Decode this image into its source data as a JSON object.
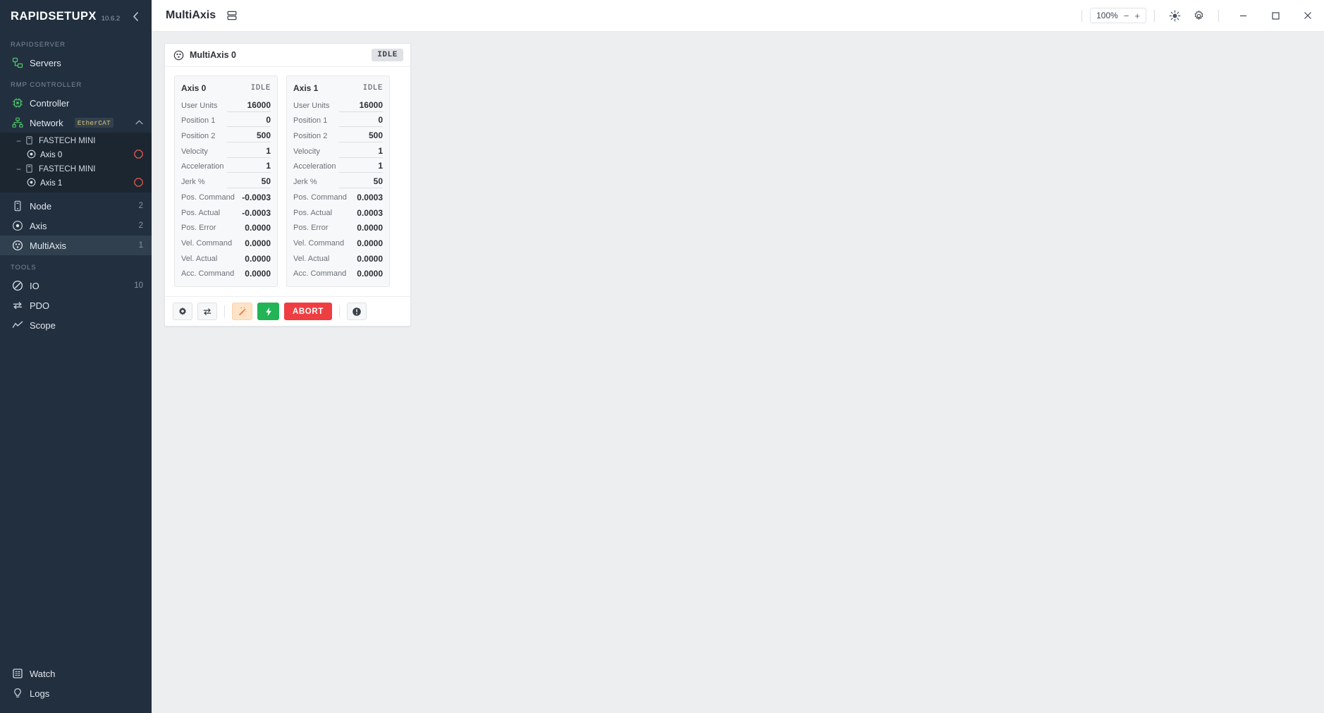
{
  "sidebar": {
    "brand": {
      "name": "RAPIDSETUPX",
      "version": "10.6.2",
      "collapse_icon": "chevron-left-icon"
    },
    "sections": [
      {
        "label": "RAPIDSERVER",
        "items": [
          {
            "label": "Servers",
            "icon": "servers-icon",
            "count": "",
            "accent": "#4ec46a"
          }
        ]
      },
      {
        "label": "RMP CONTROLLER",
        "items": [
          {
            "label": "Controller",
            "icon": "chip-icon",
            "count": "",
            "accent": "#4ec46a"
          },
          {
            "label": "Network",
            "icon": "network-icon",
            "count": "",
            "accent": "#4ec46a",
            "badge": "EtherCAT"
          },
          {
            "label": "Node",
            "icon": "node-icon",
            "count": "2",
            "accent": "#b9c3cd"
          },
          {
            "label": "Axis",
            "icon": "axis-icon",
            "count": "2",
            "accent": "#b9c3cd"
          },
          {
            "label": "MultiAxis",
            "icon": "multiaxis-icon",
            "count": "1",
            "accent": "#dfe5ea",
            "active": true
          }
        ]
      },
      {
        "label": "TOOLS",
        "items": [
          {
            "label": "IO",
            "icon": "io-icon",
            "count": "10",
            "accent": "#dfe5ea"
          },
          {
            "label": "PDO",
            "icon": "pdo-icon",
            "count": "",
            "accent": "#c3ccd6"
          },
          {
            "label": "Scope",
            "icon": "scope-icon",
            "count": "",
            "accent": "#c3ccd6"
          }
        ]
      }
    ],
    "network_tree": [
      {
        "type": "node",
        "label": "FASTECH MINI",
        "toggle": "−",
        "icon": "device-icon"
      },
      {
        "type": "leaf",
        "label": "Axis 0",
        "icon": "axis-icon",
        "status_icon": "stop-octagon-icon",
        "status_color": "#e8594c"
      },
      {
        "type": "node",
        "label": "FASTECH MINI",
        "toggle": "−",
        "icon": "device-icon"
      },
      {
        "type": "leaf",
        "label": "Axis 1",
        "icon": "axis-icon",
        "status_icon": "stop-octagon-icon",
        "status_color": "#e8594c"
      }
    ],
    "bottom_items": [
      {
        "label": "Watch",
        "icon": "watch-list-icon"
      },
      {
        "label": "Logs",
        "icon": "bulb-icon"
      }
    ]
  },
  "titlebar": {
    "title": "MultiAxis",
    "layout_icon": "split-layout-icon",
    "zoom": {
      "level": "100%",
      "minus": "−",
      "plus": "+"
    },
    "theme_icon": "sun-icon",
    "settings_icon": "gear-icon",
    "window": {
      "minimize": "−",
      "maximize": "□",
      "close": "✕"
    }
  },
  "panel": {
    "icon": "multiaxis-icon",
    "title": "MultiAxis 0",
    "state": "IDLE",
    "axes": [
      {
        "name": "Axis 0",
        "state": "IDLE",
        "fields": [
          {
            "key": "User Units",
            "value": "16000",
            "editable": true
          },
          {
            "key": "Position 1",
            "value": "0",
            "editable": true
          },
          {
            "key": "Position 2",
            "value": "500",
            "editable": true
          },
          {
            "key": "Velocity",
            "value": "1",
            "editable": true
          },
          {
            "key": "Acceleration",
            "value": "1",
            "editable": true
          },
          {
            "key": "Jerk %",
            "value": "50",
            "editable": true
          },
          {
            "key": "Pos. Command",
            "value": "-0.0003",
            "editable": false
          },
          {
            "key": "Pos. Actual",
            "value": "-0.0003",
            "editable": false
          },
          {
            "key": "Pos. Error",
            "value": "0.0000",
            "editable": false
          },
          {
            "key": "Vel. Command",
            "value": "0.0000",
            "editable": false
          },
          {
            "key": "Vel. Actual",
            "value": "0.0000",
            "editable": false
          },
          {
            "key": "Acc. Command",
            "value": "0.0000",
            "editable": false
          }
        ]
      },
      {
        "name": "Axis 1",
        "state": "IDLE",
        "fields": [
          {
            "key": "User Units",
            "value": "16000",
            "editable": true
          },
          {
            "key": "Position 1",
            "value": "0",
            "editable": true
          },
          {
            "key": "Position 2",
            "value": "500",
            "editable": true
          },
          {
            "key": "Velocity",
            "value": "1",
            "editable": true
          },
          {
            "key": "Acceleration",
            "value": "1",
            "editable": true
          },
          {
            "key": "Jerk %",
            "value": "50",
            "editable": true
          },
          {
            "key": "Pos. Command",
            "value": "0.0003",
            "editable": false
          },
          {
            "key": "Pos. Actual",
            "value": "0.0003",
            "editable": false
          },
          {
            "key": "Pos. Error",
            "value": "0.0000",
            "editable": false
          },
          {
            "key": "Vel. Command",
            "value": "0.0000",
            "editable": false
          },
          {
            "key": "Vel. Actual",
            "value": "0.0000",
            "editable": false
          },
          {
            "key": "Acc. Command",
            "value": "0.0000",
            "editable": false
          }
        ]
      }
    ],
    "footer_buttons": [
      {
        "kind": "icon",
        "name": "settings-button",
        "icon": "gear-icon",
        "label": ""
      },
      {
        "kind": "icon",
        "name": "swap-button",
        "icon": "swap-arrows-icon",
        "label": ""
      },
      {
        "kind": "sep"
      },
      {
        "kind": "wand",
        "name": "magic-wand-button",
        "icon": "magic-wand-icon",
        "label": ""
      },
      {
        "kind": "green",
        "name": "enable-button",
        "icon": "lightning-bolt-icon",
        "label": ""
      },
      {
        "kind": "abort",
        "name": "abort-button",
        "icon": "",
        "label": "ABORT"
      },
      {
        "kind": "sep"
      },
      {
        "kind": "icon",
        "name": "info-button",
        "icon": "info-icon",
        "label": ""
      }
    ]
  },
  "colors": {
    "sidebar_bg": "#222f3e",
    "sidebar_active": "#30404f",
    "tree_bg": "#1b2631",
    "accent_green": "#4ec46a",
    "abort_red": "#ef3e42",
    "enable_green": "#22b455",
    "wand_orange": "#fde3c8",
    "canvas_bg": "#eceef0",
    "status_red": "#e8594c"
  }
}
